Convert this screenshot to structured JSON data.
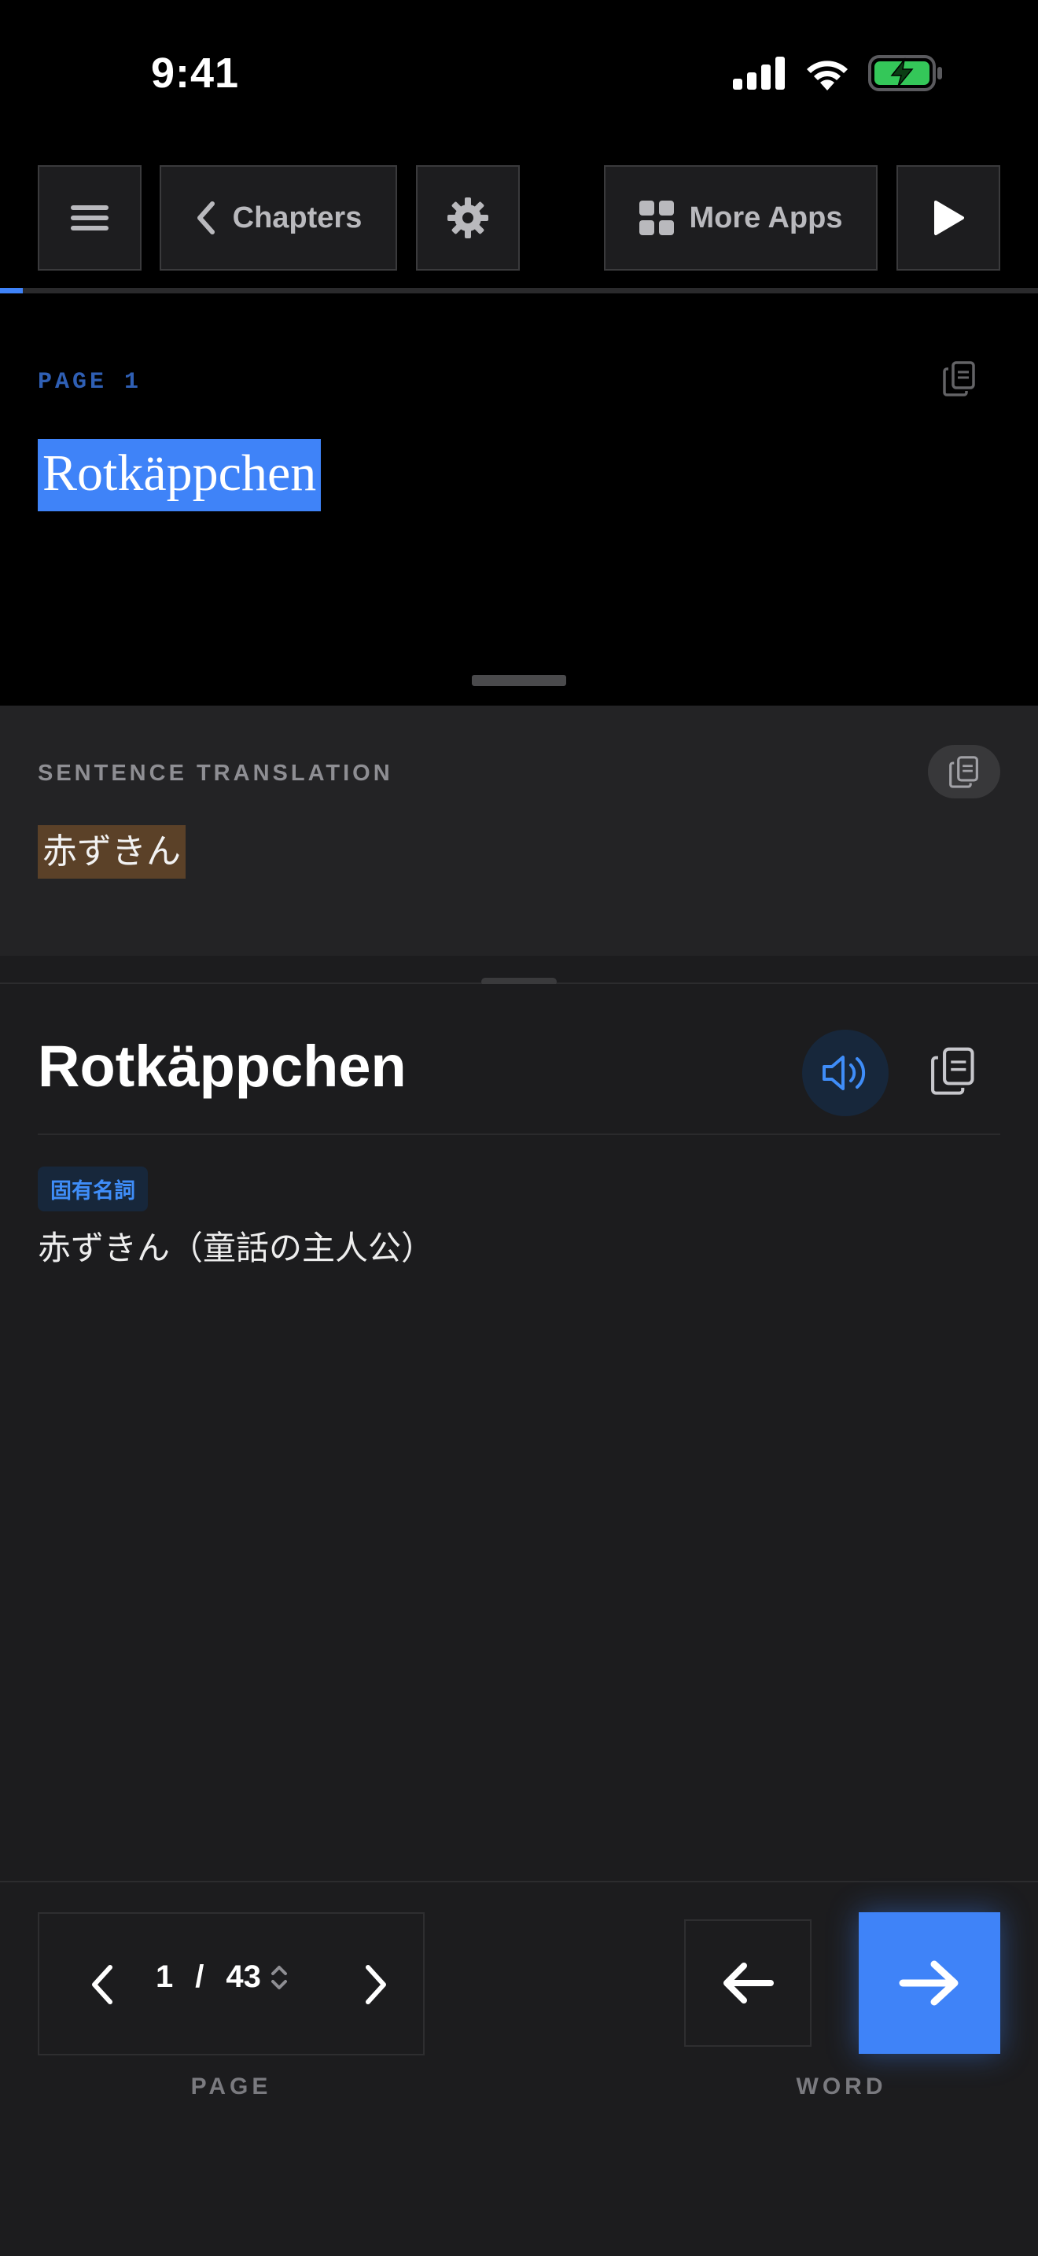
{
  "status_bar": {
    "time": "9:41"
  },
  "toolbar": {
    "menu_icon": "hamburger-icon",
    "chapters_label": "Chapters",
    "settings_icon": "gear-icon",
    "more_apps_label": "More Apps",
    "play_icon": "play-icon",
    "progress": 0.022
  },
  "reading": {
    "page_label": "PAGE 1",
    "sentence": "Rotkäppchen"
  },
  "translation": {
    "label": "SENTENCE TRANSLATION",
    "text": "赤ずきん"
  },
  "word": {
    "title": "Rotkäppchen",
    "part_of_speech": "固有名詞",
    "definition": "赤ずきん（童話の主人公）"
  },
  "pager": {
    "current": "1",
    "separator": "/",
    "total": "43",
    "label": "PAGE"
  },
  "word_nav": {
    "label": "WORD"
  },
  "colors": {
    "accent": "#3f83f8",
    "highlight_translation": "#5b4128",
    "background": "#1c1c1e"
  }
}
